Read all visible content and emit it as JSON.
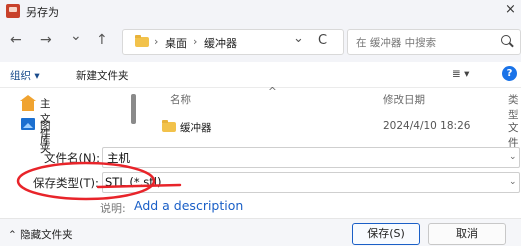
{
  "window": {
    "title": "另存为",
    "close_glyph": "×"
  },
  "nav": {
    "back_glyph": "←",
    "forward_glyph": "→",
    "history_glyph": "⌄",
    "up_glyph": "↑",
    "breadcrumb": [
      "桌面",
      "缓冲器"
    ],
    "breadcrumb_sep": "›",
    "dropdown_glyph": "⌄",
    "refresh_glyph": "C",
    "search_placeholder": "在 缓冲器 中搜索"
  },
  "toolbar": {
    "organize_label": "组织 ▾",
    "new_folder_label": "新建文件夹",
    "view_glyph": "≣ ▾",
    "help_glyph": "?"
  },
  "sidebar": {
    "items": [
      {
        "label": "主文件夹",
        "icon": "home-icon"
      },
      {
        "label": "图库",
        "icon": "gallery-icon"
      }
    ]
  },
  "file_list": {
    "columns": [
      "名称",
      "修改日期",
      "类型"
    ],
    "sort_glyph": "^",
    "rows": [
      {
        "name": "缓冲器",
        "modified": "2024/4/10 18:26",
        "type": "文件"
      }
    ]
  },
  "form": {
    "filename_label": "文件名(N):",
    "filename_value": "主机",
    "filetype_label": "保存类型(T):",
    "filetype_value": "STL (*.stl)",
    "description_label": "说明:",
    "description_link": "Add a description",
    "dropdown_glyph": "⌄"
  },
  "footer": {
    "hide_folders_label": "⌃ 隐藏文件夹",
    "save_label": "保存(S)",
    "cancel_label": "取消"
  },
  "colors": {
    "annotation_red": "#e8242a",
    "accent_blue": "#1a73e8",
    "folder_yellow": "#f2c24b"
  }
}
